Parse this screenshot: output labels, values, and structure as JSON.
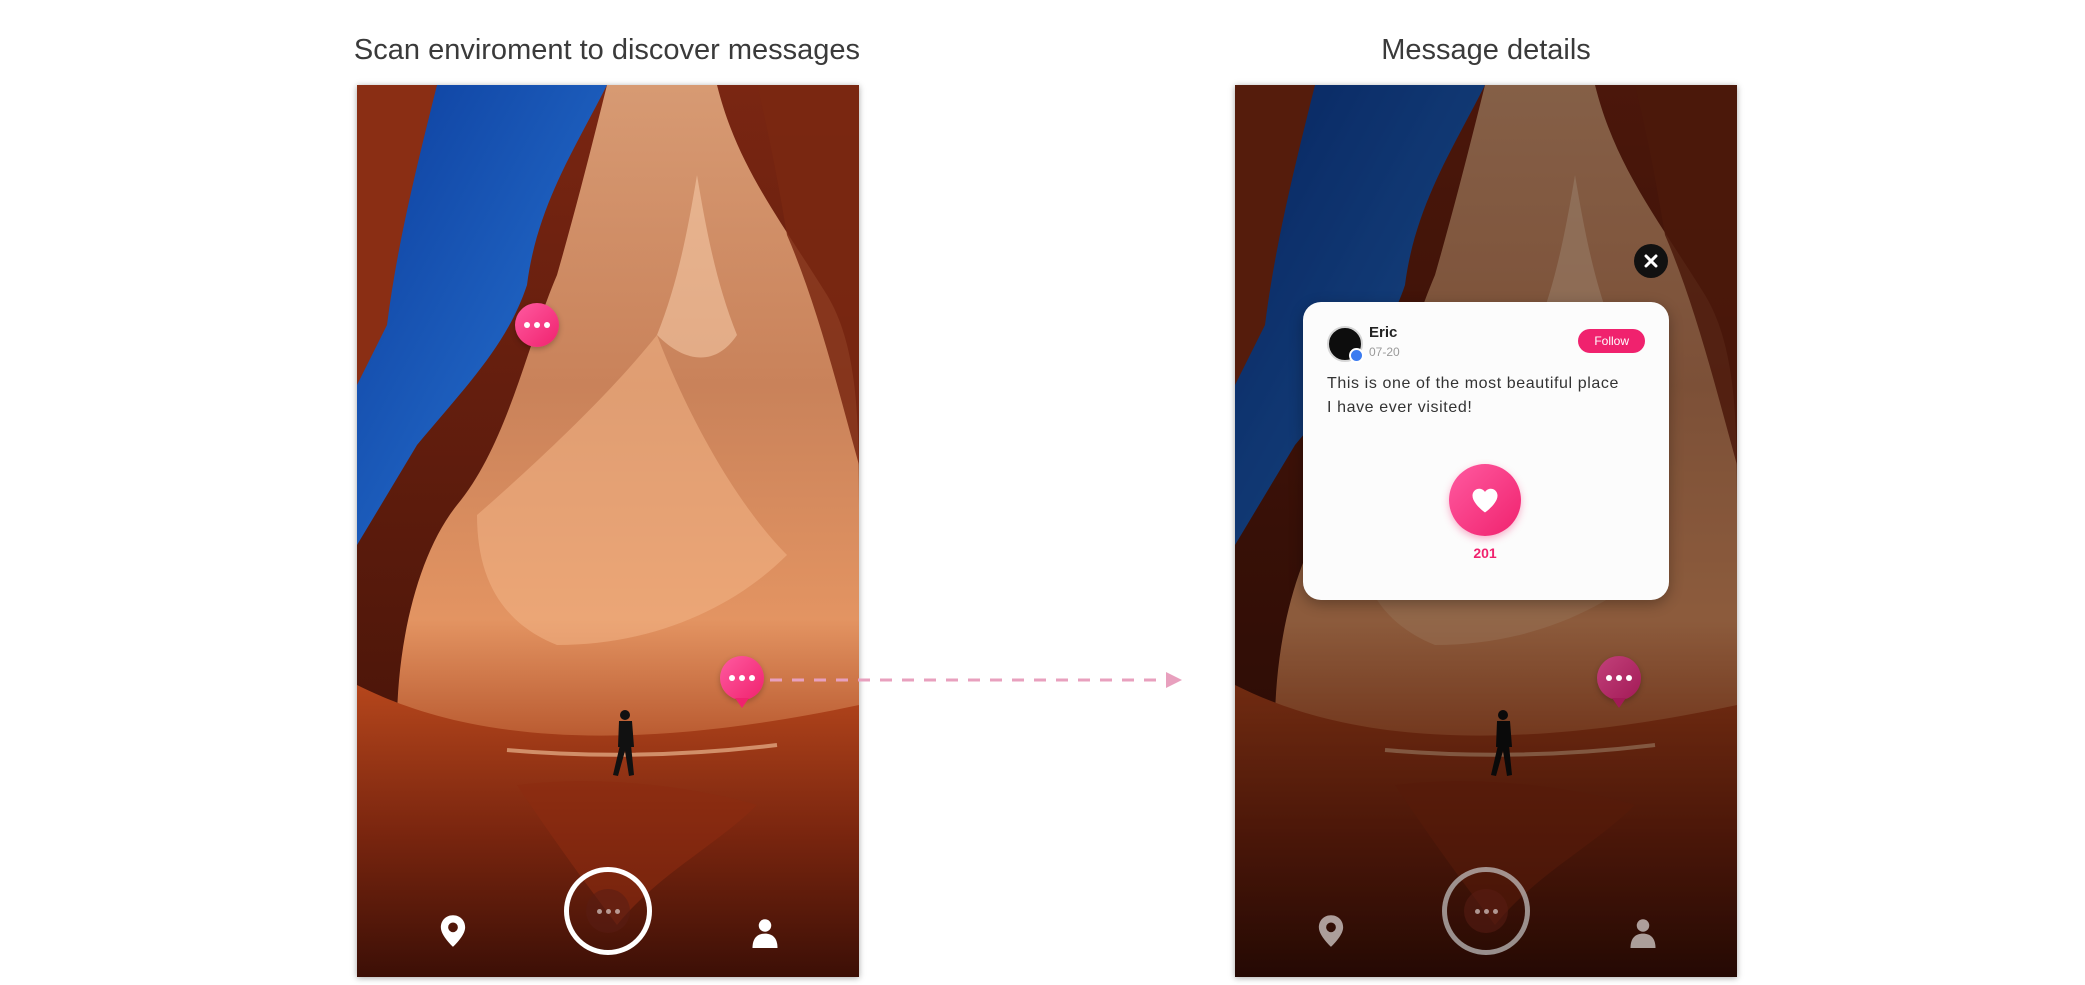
{
  "left_panel": {
    "title": "Scan enviroment to discover messages"
  },
  "right_panel": {
    "title": "Message details",
    "card": {
      "author": "Eric",
      "date": "07-20",
      "follow_label": "Follow",
      "message": "This is one of the most beautiful place I have ever visited!",
      "like_count": "201"
    }
  },
  "nav": {
    "location_icon": "location-pin-icon",
    "capture_icon": "chat-bubble-icon",
    "profile_icon": "user-icon"
  },
  "colors": {
    "accent": "#f0226e",
    "arrow": "#e8a0be",
    "sky": "#1456b8",
    "rock": "#c26a3a"
  }
}
